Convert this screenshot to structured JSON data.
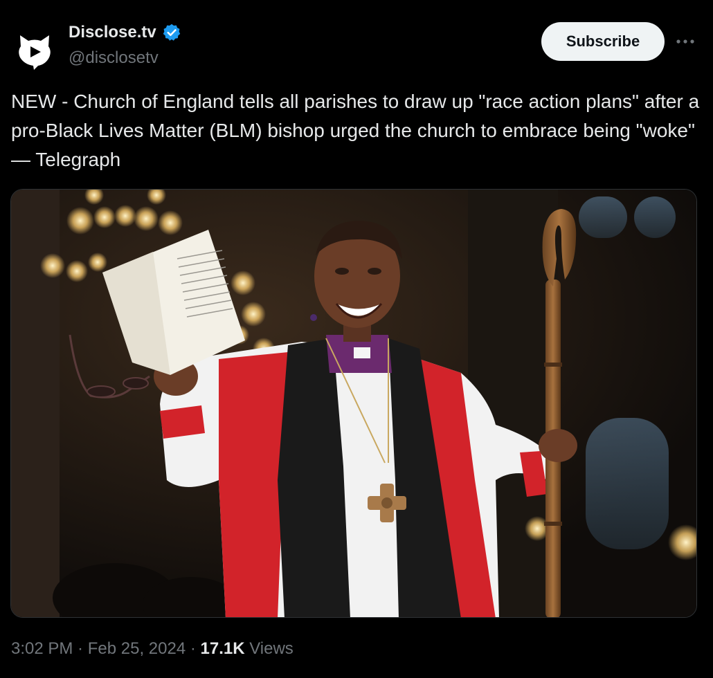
{
  "author": {
    "display_name": "Disclose.tv",
    "handle": "@disclosetv",
    "verified": true,
    "avatar_icon": "disclose-logo-icon",
    "verified_color": "#1d9bf0"
  },
  "actions": {
    "subscribe_label": "Subscribe",
    "more_icon": "more-horizontal-icon"
  },
  "tweet": {
    "text": "NEW - Church of England tells all parishes to draw up \"race action plans\" after a pro-Black Lives Matter (BLM) bishop urged the church to embrace being \"woke\" — Telegraph"
  },
  "media": {
    "subject": "photo-bishop-in-red-and-white-vestments-holding-book-and-crozier"
  },
  "meta": {
    "time": "3:02 PM",
    "separator": " · ",
    "date": "Feb 25, 2024",
    "views_count": "17.1K",
    "views_label": " Views"
  },
  "colors": {
    "background": "#000000",
    "text_primary": "#e7e9ea",
    "text_secondary": "#71767b",
    "button_bg": "#eff3f4"
  }
}
